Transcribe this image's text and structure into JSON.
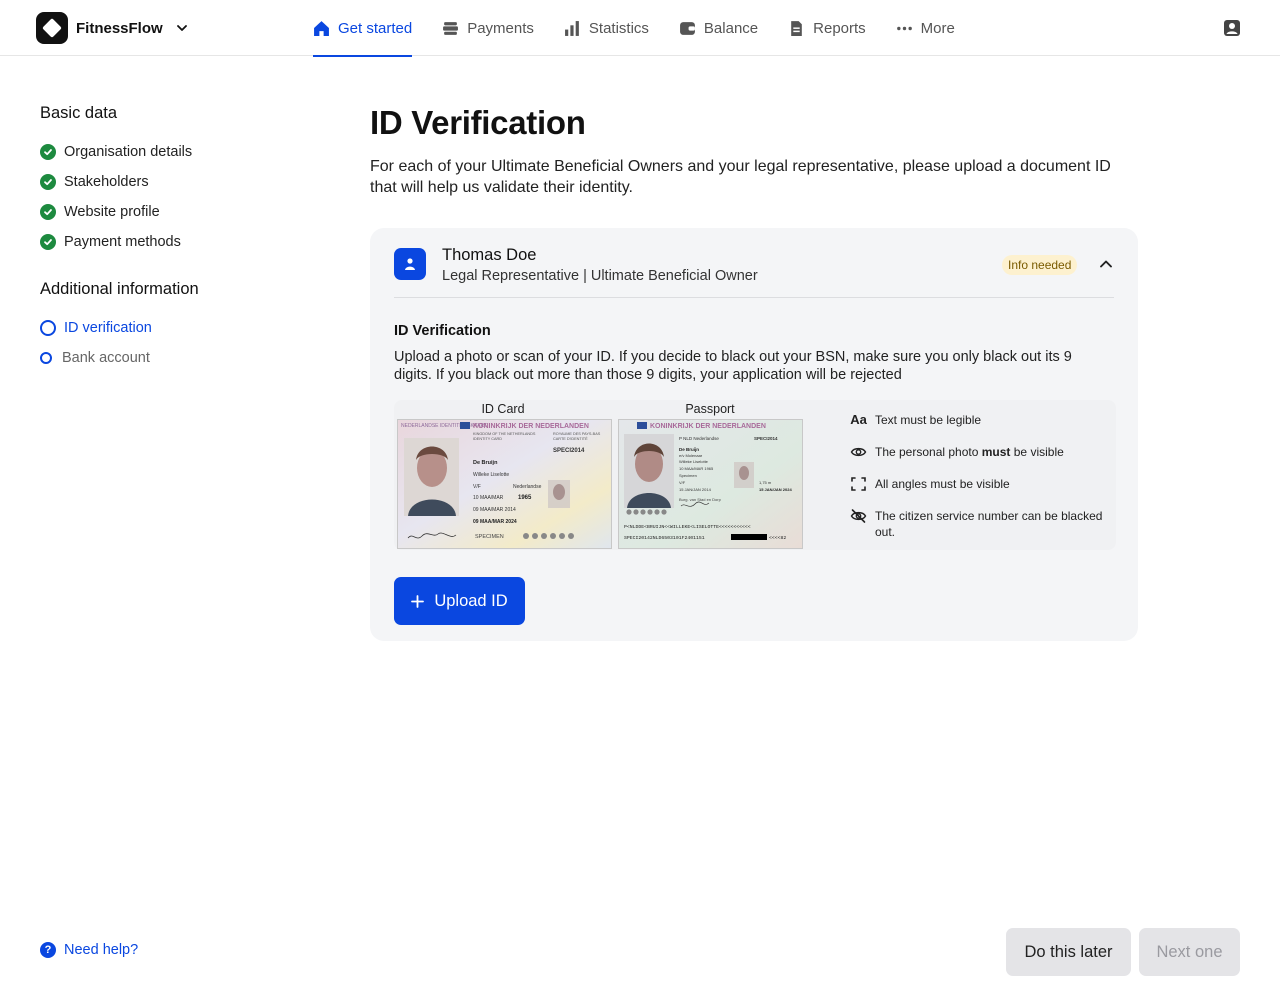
{
  "brand": {
    "name": "FitnessFlow"
  },
  "nav": {
    "items": [
      {
        "label": "Get started",
        "icon": "home-icon",
        "active": true
      },
      {
        "label": "Payments",
        "icon": "payments-icon"
      },
      {
        "label": "Statistics",
        "icon": "bar-chart-icon"
      },
      {
        "label": "Balance",
        "icon": "wallet-icon"
      },
      {
        "label": "Reports",
        "icon": "document-icon"
      },
      {
        "label": "More",
        "icon": "more-dots-icon"
      }
    ]
  },
  "sidebar": {
    "basic_heading": "Basic data",
    "basic_items": [
      {
        "label": "Organisation details",
        "status": "done"
      },
      {
        "label": "Stakeholders",
        "status": "done"
      },
      {
        "label": "Website profile",
        "status": "done"
      },
      {
        "label": "Payment methods",
        "status": "done"
      }
    ],
    "additional_heading": "Additional information",
    "additional_items": [
      {
        "label": "ID verification",
        "status": "current"
      },
      {
        "label": "Bank account",
        "status": "pending"
      }
    ]
  },
  "main": {
    "title": "ID Verification",
    "description": "For each of your Ultimate Beneficial Owners and your legal representative, please upload a document ID that will help us validate their identity."
  },
  "card": {
    "name": "Thomas Doe",
    "role": "Legal Representative | Ultimate Beneficial Owner",
    "badge": "Info needed",
    "section_title": "ID Verification",
    "section_description": "Upload a photo or scan of your ID. If you decide to black out your BSN, make sure you only black out its 9 digits. If you black out more than those 9 digits, your application will be rejected",
    "id_card_label": "ID Card",
    "passport_label": "Passport",
    "id_card_text": {
      "country_left": "NEDERLANDSE IDENTITEITSKAART",
      "country": "KONINKRIJK DER NEDERLANDEN",
      "kingdom_en": "KINGDOM OF THE NETHERLANDS",
      "royaume": "ROYAUME DES PAYS-BAS",
      "card_en": "IDENTITY CARD",
      "card_fr": "CARTE D'IDENTITÉ",
      "doc_no": "SPECI2014",
      "surname": "De Bruijn",
      "given": "Willeke Liselotte",
      "sex": "V/F",
      "nationality": "Nederlandse",
      "birth": "10 MAA/MAR",
      "birth_year": "1965",
      "issued": "09 MAA/MAR 2014",
      "expiry": "09 MAA/MAR 2024",
      "specimen": "SPECIMEN"
    },
    "passport_text": {
      "country": "KONINKRIJK DER NEDERLANDEN",
      "type_line": "P NLD Nederlandse",
      "doc_no": "SPECI2014",
      "surname": "De Bruijn",
      "spouse": "e/v Molenaar",
      "given": "Willeke Liselotte",
      "birth": "10 MAA/MAR 1965",
      "place": "Specimen",
      "sex": "V/F",
      "height": "1,75 m",
      "issued": "15 JAN/JAN 2014",
      "expiry": "15 JAN/JAN 2024",
      "authority": "Burg. van Stad en Dorp",
      "mrz1": "P<NLDDE<BRUIJN<<WILLEKE<LISELOTTE<<<<<<<<<<<",
      "mrz2": "SPECI20142NLD6503101F2401151",
      "mrz2_end": "<<<<82"
    },
    "tips": [
      {
        "icon": "text-aa-icon",
        "glyph": "Aa",
        "text": "Text must be legible"
      },
      {
        "icon": "eye-icon",
        "text_before": "The personal photo ",
        "text_bold": "must",
        "text_after": " be visible"
      },
      {
        "icon": "corners-frame-icon",
        "text": "All angles must be visible"
      },
      {
        "icon": "eye-slash-icon",
        "text": "The citizen service number can be blacked out."
      }
    ],
    "upload_label": "Upload ID"
  },
  "footer": {
    "help_label": "Need help?",
    "later_label": "Do this later",
    "next_label": "Next one"
  },
  "colors": {
    "accent": "#0a47e0",
    "success": "#1d8a3f",
    "badge_bg": "#fdf1cf",
    "badge_text": "#7a5b00"
  }
}
